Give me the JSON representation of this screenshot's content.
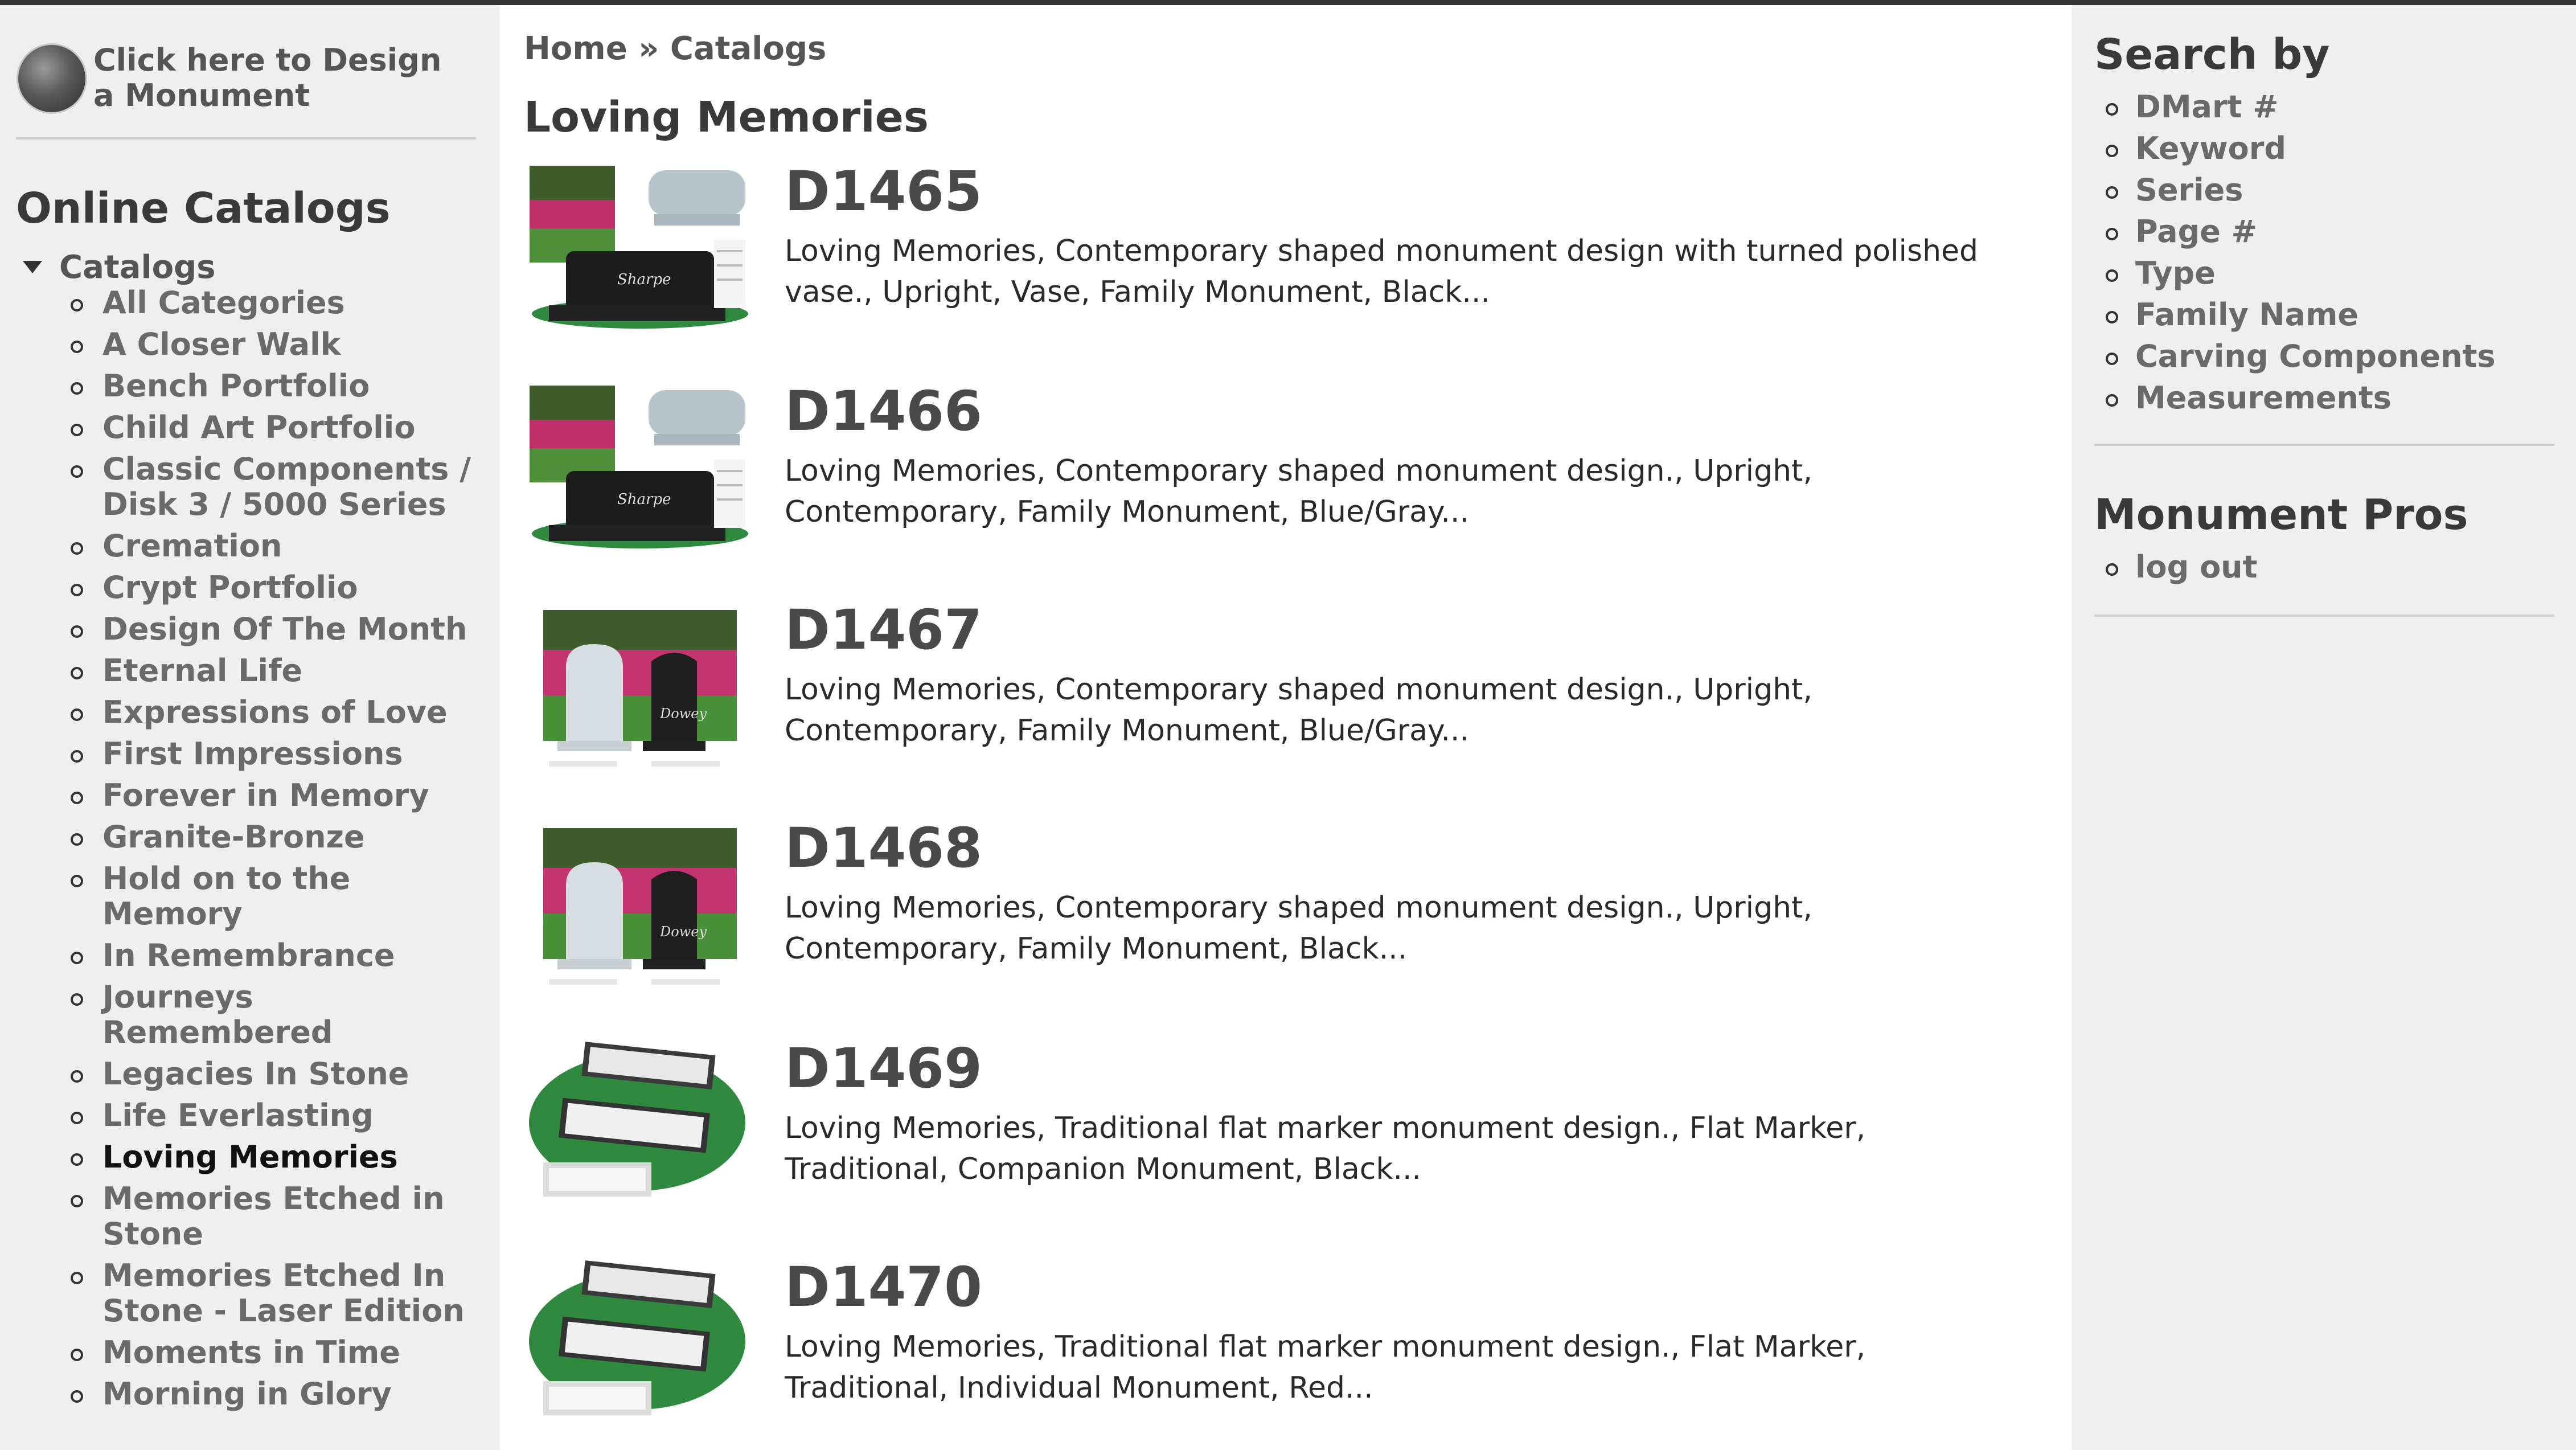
{
  "design_link": {
    "label": "Click here to Design a Monument"
  },
  "sidebar": {
    "heading": "Online Catalogs",
    "root_label": "Catalogs",
    "items": [
      "All Categories",
      "A Closer Walk",
      "Bench Portfolio",
      "Child Art Portfolio",
      "Classic Components / Disk 3 / 5000 Series",
      "Cremation",
      "Crypt Portfolio",
      "Design Of The Month",
      "Eternal Life",
      "Expressions of Love",
      "First Impressions",
      "Forever in Memory",
      "Granite-Bronze",
      "Hold on to the Memory",
      "In Remembrance",
      "Journeys Remembered",
      "Legacies In Stone",
      "Life Everlasting",
      "Loving Memories",
      "Memories Etched in Stone",
      "Memories Etched In Stone - Laser Edition",
      "Moments in Time",
      "Morning in Glory"
    ],
    "active_item": "Loving Memories"
  },
  "breadcrumb": {
    "home": "Home",
    "separator": "»",
    "current": "Catalogs"
  },
  "main": {
    "title": "Loving Memories",
    "items": [
      {
        "code": "D1465",
        "description": "Loving Memories, Contemporary shaped monument design with turned polished vase., Upright, Vase, Family Monument, Black...",
        "thumb": "upright-dark"
      },
      {
        "code": "D1466",
        "description": "Loving Memories, Contemporary shaped monument design., Upright, Contemporary, Family Monument, Blue/Gray...",
        "thumb": "upright-dark"
      },
      {
        "code": "D1467",
        "description": "Loving Memories, Contemporary shaped monument design., Upright, Contemporary, Family Monument, Blue/Gray...",
        "thumb": "upright-pair"
      },
      {
        "code": "D1468",
        "description": "Loving Memories, Contemporary shaped monument design., Upright, Contemporary, Family Monument, Black...",
        "thumb": "upright-pair"
      },
      {
        "code": "D1469",
        "description": "Loving Memories, Traditional flat marker monument design., Flat Marker, Traditional, Companion Monument, Black...",
        "thumb": "flat-marker"
      },
      {
        "code": "D1470",
        "description": "Loving Memories, Traditional flat marker monument design., Flat Marker, Traditional, Individual Monument, Red...",
        "thumb": "flat-marker"
      }
    ]
  },
  "search": {
    "heading": "Search by",
    "items": [
      "DMart #",
      "Keyword",
      "Series",
      "Page #",
      "Type",
      "Family Name",
      "Carving Components",
      "Measurements"
    ]
  },
  "pros": {
    "heading": "Monument Pros",
    "items": [
      "log out"
    ]
  }
}
